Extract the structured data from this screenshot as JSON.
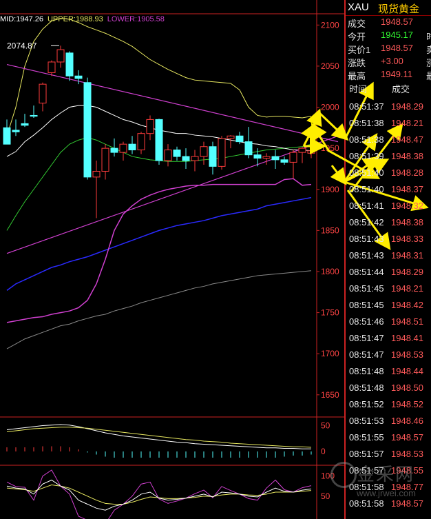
{
  "legend": {
    "mid_label": "MID:1947.26",
    "upper_label": "UPPER:1988.93",
    "lower_label": "LOWER:1905.58"
  },
  "colors": {
    "up": "#ff3b3b",
    "down": "#54ffff",
    "axis": "#cc2222",
    "upper_band": "#e8e860",
    "mid_band": "#ffffff",
    "lower_band": "#d040d0",
    "ma_green": "#33cc33",
    "ma_blue": "#2a2aff",
    "ma_gray": "#8a8a8a",
    "trendline": "#d040d0",
    "arrow": "#ffee00",
    "quote_green": "#33ff33"
  },
  "quote": {
    "symbol": "XAU",
    "name": "现货黄金",
    "rows": [
      {
        "label": "成交",
        "value": "1948.57",
        "color": "#ff5a5a",
        "label2": ""
      },
      {
        "label": "今开",
        "value": "1945.17",
        "color": "#33ff33",
        "label2": "时"
      },
      {
        "label": "买价1",
        "value": "1948.57",
        "color": "#ff5a5a",
        "label2": "卖"
      },
      {
        "label": "涨跌",
        "value": "+3.00",
        "color": "#ff5a5a",
        "label2": "涨"
      },
      {
        "label": "最高",
        "value": "1949.11",
        "color": "#ff5a5a",
        "label2": "最"
      }
    ],
    "tick_header": {
      "time": "时间",
      "price": "成交"
    }
  },
  "ticks": [
    {
      "time": "08:51:37",
      "price": "1948.29"
    },
    {
      "time": "08:51:38",
      "price": "1948.21"
    },
    {
      "time": "08:51:38",
      "price": "1948.47"
    },
    {
      "time": "08:51:39",
      "price": "1948.38"
    },
    {
      "time": "08:51:40",
      "price": "1948.28"
    },
    {
      "time": "08:51:40",
      "price": "1948.37"
    },
    {
      "time": "08:51:41",
      "price": "1948.32"
    },
    {
      "time": "08:51:42",
      "price": "1948.38"
    },
    {
      "time": "08:51:43",
      "price": "1948.33"
    },
    {
      "time": "08:51:43",
      "price": "1948.31"
    },
    {
      "time": "08:51:44",
      "price": "1948.29"
    },
    {
      "time": "08:51:45",
      "price": "1948.21"
    },
    {
      "time": "08:51:45",
      "price": "1948.42"
    },
    {
      "time": "08:51:46",
      "price": "1948.51"
    },
    {
      "time": "08:51:47",
      "price": "1948.41"
    },
    {
      "time": "08:51:47",
      "price": "1948.53"
    },
    {
      "time": "08:51:48",
      "price": "1948.44"
    },
    {
      "time": "08:51:48",
      "price": "1948.50"
    },
    {
      "time": "08:51:52",
      "price": "1948.52"
    },
    {
      "time": "08:51:53",
      "price": "1948.46"
    },
    {
      "time": "08:51:55",
      "price": "1948.57"
    },
    {
      "time": "08:51:57",
      "price": "1948.53"
    },
    {
      "time": "08:51:57",
      "price": "1948.55"
    },
    {
      "time": "08:51:58",
      "price": "1948.77"
    },
    {
      "time": "08:51:58",
      "price": "1948.57"
    }
  ],
  "watermark": {
    "text": "金采网",
    "url": "www.jrwei.com"
  },
  "chart_data": {
    "type": "candlestick",
    "title": "",
    "price_axis": {
      "ticks": [
        2100,
        2050,
        2000,
        1950,
        1900,
        1850,
        1800,
        1750,
        1700,
        1650
      ],
      "ylim": [
        1623,
        2112
      ]
    },
    "annotation": {
      "text": "2074.87",
      "value": 2074.87,
      "index": 6
    },
    "candles": [
      [
        1975,
        1985,
        1960,
        1955
      ],
      [
        1972,
        1985,
        1965,
        1970
      ],
      [
        1980,
        1992,
        1976,
        1978
      ],
      [
        1990,
        2002,
        1987,
        1989
      ],
      [
        2005,
        2030,
        1995,
        2028
      ],
      [
        2042,
        2057,
        2038,
        2055
      ],
      [
        2055,
        2074.87,
        2048,
        2070
      ],
      [
        2066,
        2068,
        2032,
        2038
      ],
      [
        2038,
        2045,
        2028,
        2035
      ],
      [
        2030,
        2036,
        1912,
        1915
      ],
      [
        1915,
        1935,
        1865,
        1922
      ],
      [
        1922,
        1955,
        1912,
        1950
      ],
      [
        1950,
        1962,
        1940,
        1945
      ],
      [
        1945,
        1958,
        1935,
        1955
      ],
      [
        1955,
        1965,
        1943,
        1948
      ],
      [
        1948,
        1970,
        1943,
        1968
      ],
      [
        1968,
        1990,
        1960,
        1985
      ],
      [
        1985,
        1986,
        1930,
        1935
      ],
      [
        1935,
        1955,
        1928,
        1948
      ],
      [
        1948,
        1952,
        1935,
        1940
      ],
      [
        1940,
        1950,
        1925,
        1935
      ],
      [
        1935,
        1948,
        1922,
        1940
      ],
      [
        1940,
        1958,
        1930,
        1952
      ],
      [
        1952,
        1958,
        1918,
        1928
      ],
      [
        1928,
        1965,
        1924,
        1962
      ],
      [
        1962,
        1966,
        1950,
        1965
      ],
      [
        1965,
        1970,
        1955,
        1958
      ],
      [
        1958,
        1976,
        1938,
        1942
      ],
      [
        1942,
        1950,
        1928,
        1938
      ],
      [
        1938,
        1944,
        1930,
        1940
      ],
      [
        1940,
        1948,
        1925,
        1936
      ],
      [
        1936,
        1940,
        1930,
        1933
      ],
      [
        1933,
        1948,
        1913,
        1945
      ],
      [
        1945,
        1952,
        1932,
        1950
      ],
      [
        1944,
        1962,
        1938,
        1947
      ]
    ],
    "upper_band": [
      1965,
      2000,
      2050,
      2080,
      2095,
      2105,
      2108,
      2107,
      2103,
      2098,
      2094,
      2090,
      2085,
      2080,
      2074,
      2066,
      2058,
      2052,
      2046,
      2041,
      2036,
      2033,
      2032,
      2031,
      2030,
      2029,
      2021,
      2000,
      1990,
      1988,
      1989,
      1989,
      1988,
      1987,
      1989
    ],
    "mid_band": [
      1940,
      1946,
      1958,
      1966,
      1975,
      1985,
      1993,
      2000,
      2002,
      2002,
      2000,
      1995,
      1990,
      1985,
      1982,
      1978,
      1975,
      1972,
      1970,
      1968,
      1968,
      1966,
      1965,
      1964,
      1962,
      1960,
      1958,
      1956,
      1955,
      1953,
      1952,
      1950,
      1948,
      1948,
      1947
    ],
    "lower_band": [
      1738,
      1740,
      1742,
      1744,
      1745,
      1748,
      1750,
      1752,
      1756,
      1765,
      1785,
      1815,
      1850,
      1870,
      1880,
      1888,
      1893,
      1897,
      1900,
      1902,
      1904,
      1905,
      1905,
      1906,
      1906,
      1906,
      1906,
      1906,
      1906,
      1906,
      1906,
      1912,
      1913,
      1905,
      1906
    ],
    "ma_green": [
      1850,
      1868,
      1885,
      1900,
      1915,
      1930,
      1945,
      1955,
      1960,
      1963,
      1960,
      1955,
      1950,
      1945,
      1940,
      1938,
      1936,
      1935,
      1934,
      1934,
      1934,
      1935,
      1936,
      1937,
      1938,
      1940,
      1942,
      1944,
      1946,
      1948,
      1949,
      1950,
      1951,
      1952,
      1955
    ],
    "ma_blue": [
      1777,
      1785,
      1790,
      1795,
      1800,
      1805,
      1808,
      1812,
      1815,
      1818,
      1822,
      1826,
      1830,
      1834,
      1838,
      1842,
      1846,
      1850,
      1853,
      1856,
      1858,
      1860,
      1862,
      1865,
      1868,
      1870,
      1872,
      1874,
      1876,
      1880,
      1882,
      1884,
      1886,
      1888,
      1890
    ],
    "ma_gray": [
      1706,
      1712,
      1718,
      1722,
      1726,
      1730,
      1734,
      1736,
      1740,
      1743,
      1746,
      1748,
      1752,
      1755,
      1758,
      1762,
      1765,
      1768,
      1771,
      1774,
      1777,
      1780,
      1782,
      1785,
      1787,
      1789,
      1791,
      1793,
      1795,
      1796,
      1797,
      1798,
      1799,
      1800,
      1801
    ],
    "trendlines": [
      {
        "from": [
          0,
          2052
        ],
        "to": [
          37,
          1958
        ]
      },
      {
        "from": [
          0,
          1822
        ],
        "to": [
          37,
          1965
        ]
      }
    ],
    "macd": {
      "ticks": [
        50,
        0
      ],
      "ylim": [
        -20,
        60
      ],
      "dif": [
        42,
        44,
        46,
        48,
        50,
        51,
        52,
        51,
        48,
        44,
        40,
        36,
        33,
        30,
        28,
        26,
        24,
        22,
        20,
        18,
        17,
        15,
        14,
        13,
        12,
        11,
        10,
        9,
        8,
        7,
        7,
        6,
        6,
        5,
        5
      ],
      "dea": [
        38,
        40,
        42,
        44,
        45,
        46,
        47,
        47,
        46,
        45,
        43,
        41,
        39,
        37,
        35,
        33,
        31,
        29,
        27,
        25,
        23,
        22,
        20,
        19,
        18,
        16,
        15,
        14,
        13,
        12,
        11,
        10,
        9,
        9,
        8
      ],
      "hist": [
        8,
        8,
        8,
        8,
        10,
        10,
        10,
        8,
        4,
        -2,
        -6,
        -10,
        -12,
        -12,
        -12,
        -12,
        -12,
        -12,
        -12,
        -12,
        -12,
        -12,
        -12,
        -12,
        -12,
        -12,
        -12,
        -12,
        -12,
        -12,
        -12,
        -10,
        -8,
        -8,
        -6
      ]
    },
    "kdj": {
      "ticks": [
        100,
        50
      ],
      "ylim": [
        0,
        120
      ],
      "k": [
        75,
        70,
        68,
        55,
        80,
        90,
        75,
        65,
        40,
        30,
        20,
        15,
        25,
        30,
        40,
        55,
        60,
        45,
        40,
        42,
        45,
        50,
        55,
        48,
        60,
        58,
        55,
        50,
        48,
        60,
        70,
        62,
        60,
        65,
        68
      ],
      "d": [
        70,
        68,
        66,
        62,
        70,
        78,
        75,
        70,
        60,
        50,
        40,
        32,
        30,
        30,
        35,
        42,
        48,
        46,
        44,
        44,
        45,
        47,
        50,
        49,
        53,
        55,
        55,
        53,
        52,
        55,
        60,
        60,
        60,
        62,
        64
      ],
      "j": [
        85,
        74,
        72,
        40,
        100,
        115,
        75,
        55,
        0,
        -10,
        -20,
        -19,
        15,
        30,
        50,
        80,
        85,
        43,
        32,
        38,
        45,
        56,
        65,
        46,
        74,
        64,
        55,
        44,
        40,
        70,
        90,
        66,
        60,
        71,
        76
      ]
    },
    "annotation_arrows": [
      {
        "from": [
          477,
          218
        ],
        "to": [
          455,
          183
        ]
      },
      {
        "from": [
          455,
          183
        ],
        "to": [
          463,
          163
        ]
      },
      {
        "from": [
          463,
          163
        ],
        "to": [
          502,
          200
        ]
      },
      {
        "from": [
          502,
          200
        ],
        "to": [
          540,
          124
        ]
      },
      {
        "from": [
          441,
          212
        ],
        "to": [
          456,
          183
        ]
      },
      {
        "from": [
          476,
          218
        ],
        "to": [
          547,
          257
        ]
      },
      {
        "from": [
          441,
          212
        ],
        "to": [
          468,
          212
        ]
      },
      {
        "from": [
          482,
          240
        ],
        "to": [
          500,
          264
        ]
      },
      {
        "from": [
          500,
          264
        ],
        "to": [
          547,
          230
        ]
      },
      {
        "from": [
          500,
          264
        ],
        "to": [
          545,
          198
        ]
      },
      {
        "from": [
          500,
          264
        ],
        "to": [
          560,
          233
        ]
      },
      {
        "from": [
          505,
          276
        ],
        "to": [
          564,
          358
        ]
      },
      {
        "from": [
          510,
          278
        ],
        "to": [
          582,
          183
        ]
      },
      {
        "from": [
          500,
          264
        ],
        "to": [
          617,
          300
        ]
      }
    ]
  }
}
